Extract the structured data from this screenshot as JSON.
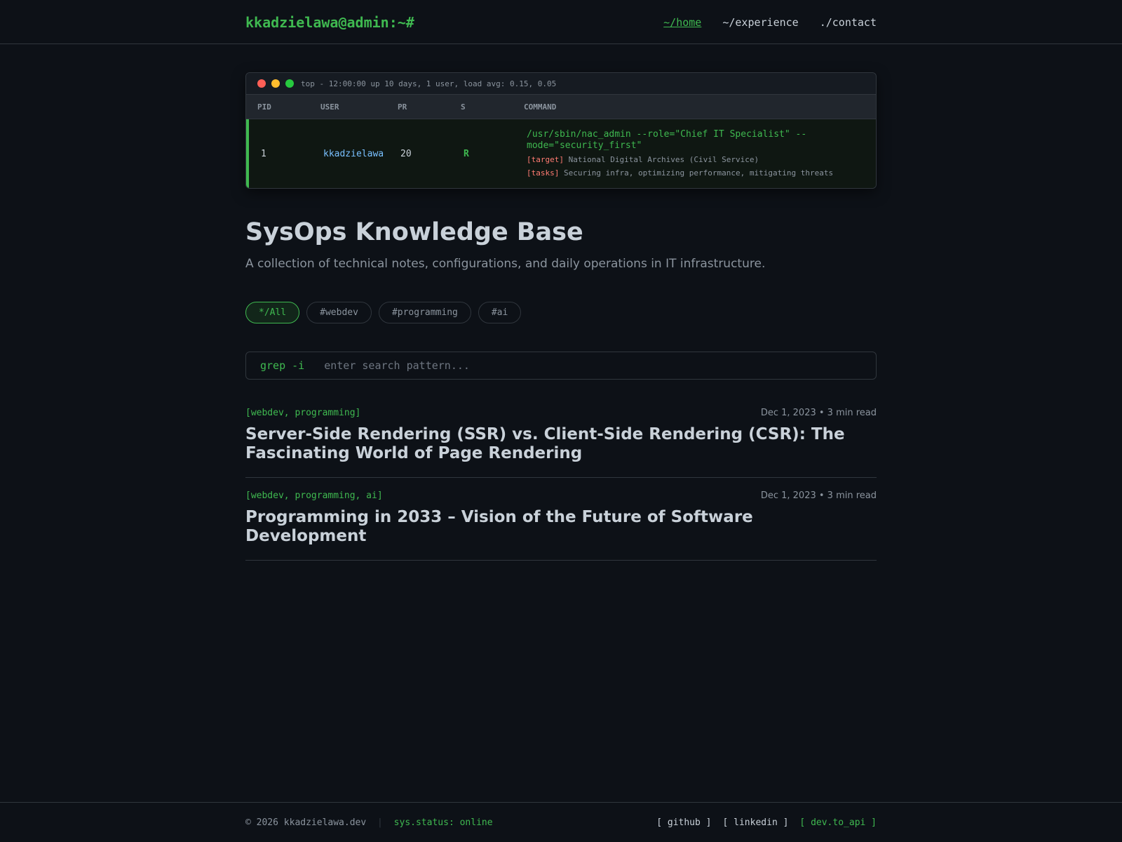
{
  "header": {
    "logo": "kkadzielawa@admin:~#",
    "nav": [
      {
        "label": "~/home"
      },
      {
        "label": "~/experience"
      },
      {
        "label": "./contact"
      }
    ]
  },
  "terminal": {
    "title": "top - 12:00:00 up 10 days, 1 user, load avg: 0.15, 0.05",
    "columns": [
      "PID",
      "USER",
      "PR",
      "S",
      "COMMAND"
    ],
    "row": {
      "pid": "1",
      "user": "kkadzielawa",
      "pr": "20",
      "s": "R",
      "command": "/usr/sbin/nac_admin --role=\"Chief IT Specialist\" --mode=\"security_first\"",
      "target_tag": "[target]",
      "target": "National Digital Archives (Civil Service)",
      "tasks_tag": "[tasks]",
      "tasks": "Securing infra, optimizing performance, mitigating threats"
    }
  },
  "page": {
    "title": "SysOps Knowledge Base",
    "subtitle": "A collection of technical notes, configurations, and daily operations in IT infrastructure."
  },
  "filters": [
    {
      "label": "*/All",
      "active": true
    },
    {
      "label": "#webdev"
    },
    {
      "label": "#programming"
    },
    {
      "label": "#ai"
    }
  ],
  "search": {
    "prefix": "grep -i",
    "placeholder": "enter search pattern..."
  },
  "posts": [
    {
      "tags": "[webdev, programming]",
      "date": "Dec 1, 2023 • 3 min read",
      "title": "Server-Side Rendering (SSR) vs. Client-Side Rendering (CSR): The Fascinating World of Page Rendering"
    },
    {
      "tags": "[webdev, programming, ai]",
      "date": "Dec 1, 2023 • 3 min read",
      "title": "Programming in 2033 – Vision of the Future of Software Development"
    }
  ],
  "footer": {
    "copyright": "© 2026 kkadzielawa.dev",
    "separator": "|",
    "status": "sys.status: online",
    "links": [
      {
        "label": "[ github ]"
      },
      {
        "label": "[ linkedin ]"
      },
      {
        "label": "[ dev.to_api ]"
      }
    ]
  },
  "colors": {
    "background": "#0d1117",
    "accent": "#3fb950",
    "text": "#c9d1d9",
    "muted": "#8b949e",
    "user": "#79c0ff",
    "tag": "#ff7b72"
  }
}
